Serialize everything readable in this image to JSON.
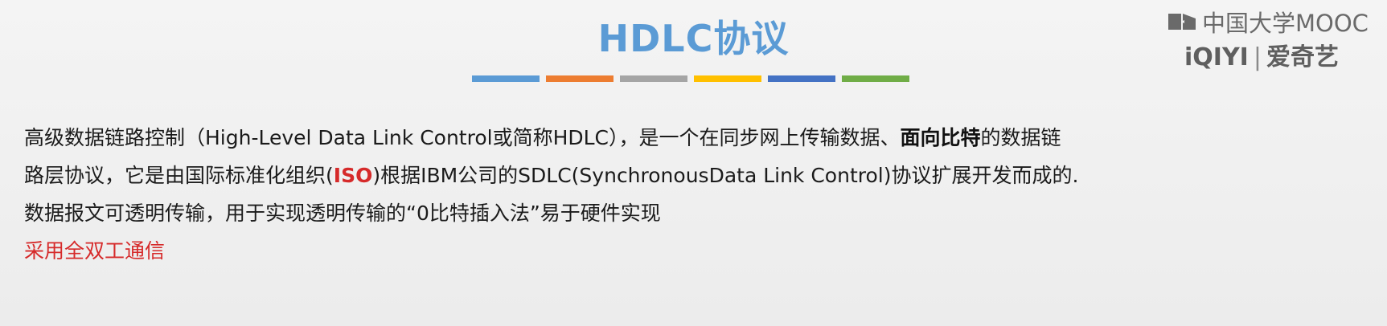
{
  "slide": {
    "title": "HDLC协议",
    "color_bars": [
      "#5b9bd5",
      "#ed7d31",
      "#a5a5a5",
      "#ffc000",
      "#4472c4",
      "#70ad47"
    ]
  },
  "watermark": {
    "line1": "中国大学MOOC",
    "line2_brand": "iQIYI",
    "line2_cn": "爱奇艺",
    "icons": [
      "mooc-logo-icon"
    ]
  },
  "body": {
    "para1": {
      "l1a": "高级数据链路控制（High-Level Data Link Control或简称HDLC），是一个在同步网上传输数据、",
      "l1b": "面向比特",
      "l1c": "的数据链",
      "l2a": "路层协议，它是由国际标准化组织(",
      "l2b": "ISO",
      "l2c": ")根据IBM公司的SDLC(SynchronousData Link Control)协议扩展开发而成的."
    },
    "para2": "数据报文可透明传输，用于实现透明传输的“0比特插入法”易于硬件实现",
    "para3": "采用全双工通信"
  }
}
